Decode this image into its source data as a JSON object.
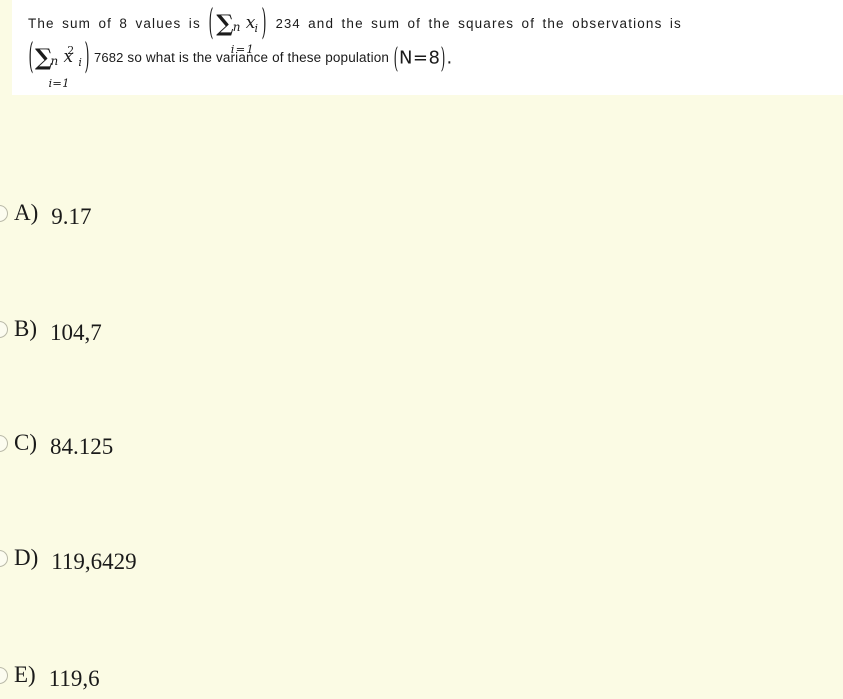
{
  "question": {
    "line1": {
      "before": "The sum of 8 values is",
      "formula": {
        "open_paren": "(",
        "sigma": "∑",
        "upper_limit": "n",
        "lower_limit": "i=1",
        "variable": "x",
        "var_sub": "i",
        "close_paren": ")"
      },
      "value": "234",
      "after": "and the sum of the squares of the observations is"
    },
    "line2": {
      "formula": {
        "open_paren": "(",
        "sigma": "∑",
        "upper_limit": "n",
        "lower_limit": "i=1",
        "variable": "x",
        "var_sub": "i",
        "var_sup": "2",
        "close_paren": ")"
      },
      "value": "7682",
      "middle": "so what is the variance of these population",
      "population": {
        "open_paren": "(",
        "text": "N=8",
        "close_paren": ")"
      },
      "period": "."
    }
  },
  "options": [
    {
      "letter": "A)",
      "value": "9.17",
      "radio_icon": "radio-unchecked-icon",
      "selected": false
    },
    {
      "letter": "B)",
      "value": "104,7",
      "radio_icon": "radio-unchecked-icon",
      "selected": false
    },
    {
      "letter": "C)",
      "value": "84.125",
      "radio_icon": "radio-unchecked-icon",
      "selected": false
    },
    {
      "letter": "D)",
      "value": "119,6429",
      "radio_icon": "radio-unchecked-icon",
      "selected": false
    },
    {
      "letter": "E)",
      "value": "119,6",
      "radio_icon": "radio-unchecked-icon",
      "selected": false
    }
  ],
  "colors": {
    "page_background": "#fbfbe4",
    "card_background": "#ffffff",
    "text": "#1a1a1a",
    "radio_border": "#b9b9a8"
  }
}
